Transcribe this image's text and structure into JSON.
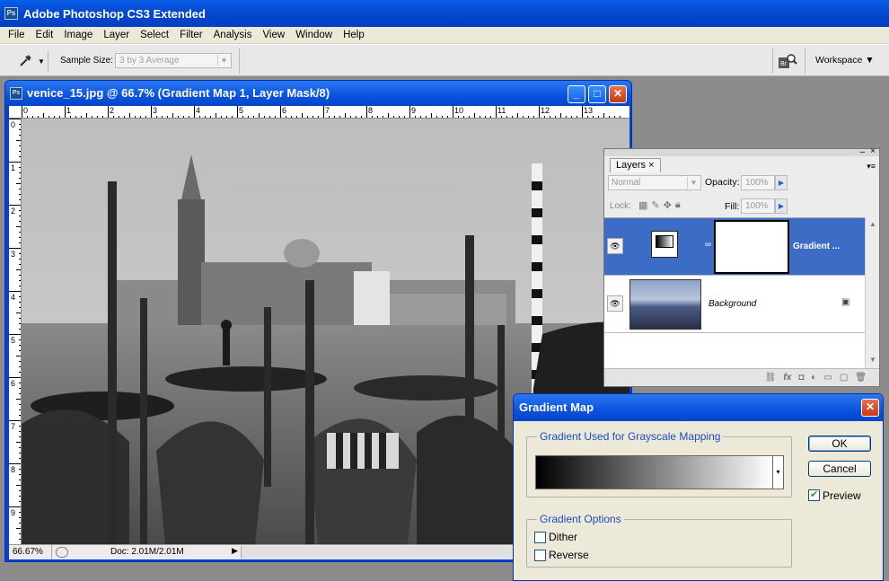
{
  "app": {
    "title": "Adobe Photoshop CS3 Extended",
    "ps_icon": "Ps"
  },
  "menu": [
    "File",
    "Edit",
    "Image",
    "Layer",
    "Select",
    "Filter",
    "Analysis",
    "View",
    "Window",
    "Help"
  ],
  "options_bar": {
    "tool_icon": "eyedropper-icon",
    "sample_size_label": "Sample Size:",
    "sample_size_value": "3 by 3 Average",
    "workspace_label": "Workspace ▼"
  },
  "document": {
    "title": "venice_15.jpg @ 66.7% (Gradient Map 1, Layer Mask/8)",
    "ruler_top": [
      "0",
      "1",
      "2",
      "3",
      "4",
      "5",
      "6",
      "7",
      "8",
      "9",
      "10",
      "11",
      "12",
      "13"
    ],
    "ruler_left": [
      "0",
      "1",
      "2",
      "3",
      "4",
      "5",
      "6",
      "7",
      "8",
      "9"
    ],
    "status": {
      "zoom": "66.67%",
      "doc": "Doc: 2.01M/2.01M"
    }
  },
  "layers_panel": {
    "tab_label": "Layers",
    "tab_close": "×",
    "blend_mode": "Normal",
    "opacity_label": "Opacity:",
    "opacity_value": "100%",
    "lock_label": "Lock:",
    "fill_label": "Fill:",
    "fill_value": "100%",
    "layers": [
      {
        "name": "Gradient ...",
        "selected": true
      },
      {
        "name": "Background",
        "selected": false
      }
    ]
  },
  "dialog": {
    "title": "Gradient Map",
    "group1_label": "Gradient Used for Grayscale Mapping",
    "group2_label": "Gradient Options",
    "ok_label": "OK",
    "cancel_label": "Cancel",
    "preview_label": "Preview",
    "preview_checked": true,
    "dither_label": "Dither",
    "dither_checked": false,
    "reverse_label": "Reverse",
    "reverse_checked": false
  },
  "colors": {
    "xp_blue": "#0a52e0",
    "layer_selected": "#3d6cc6",
    "dialog_bg": "#ece9d8",
    "group_label": "#1a4ec0"
  }
}
